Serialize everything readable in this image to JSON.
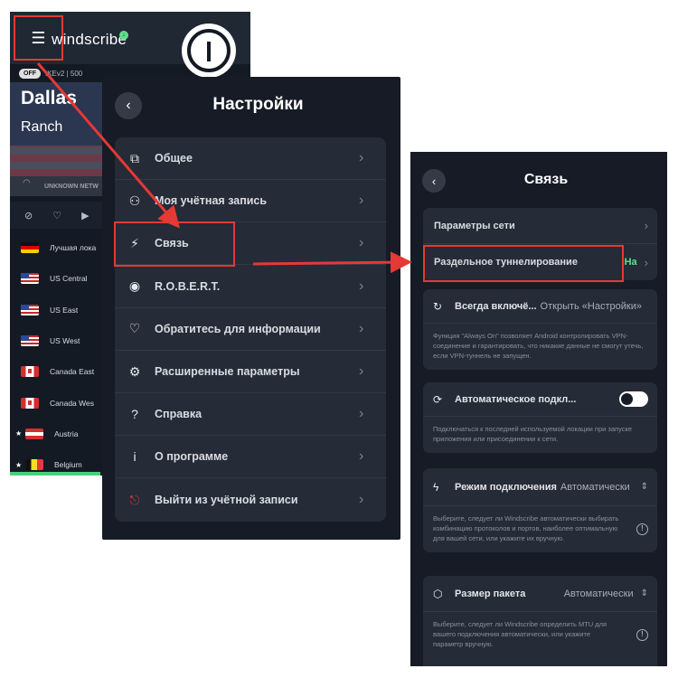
{
  "app": {
    "brand": "windscribe",
    "status": "OFF",
    "protocol": "IKEv2 | 500",
    "city": "Dallas",
    "node": "Ranch",
    "network": "UNKNOWN NETW",
    "locations": [
      {
        "name": "Лучшая лока",
        "flag": "de"
      },
      {
        "name": "US Central",
        "flag": "us"
      },
      {
        "name": "US East",
        "flag": "us"
      },
      {
        "name": "US West",
        "flag": "us"
      },
      {
        "name": "Canada East",
        "flag": "ca"
      },
      {
        "name": "Canada Wes",
        "flag": "ca"
      },
      {
        "name": "Austria",
        "flag": "at"
      },
      {
        "name": "Belgium",
        "flag": "be"
      }
    ]
  },
  "settings": {
    "title": "Настройки",
    "items": [
      {
        "label": "Общее",
        "icon": "general-icon"
      },
      {
        "label": "Моя учётная запись",
        "icon": "user-icon"
      },
      {
        "label": "Связь",
        "icon": "connection-icon"
      },
      {
        "label": "R.O.B.E.R.T.",
        "icon": "robert-icon"
      },
      {
        "label": "Обратитесь для информации",
        "icon": "heart-icon"
      },
      {
        "label": "Расширенные параметры",
        "icon": "gear-icon"
      },
      {
        "label": "Справка",
        "icon": "help-icon"
      },
      {
        "label": "О программе",
        "icon": "info-icon"
      },
      {
        "label": "Выйти из учётной записи",
        "icon": "logout-icon"
      }
    ]
  },
  "connection": {
    "title": "Связь",
    "network_params": "Параметры сети",
    "split_tunnel": "Раздельное туннелирование",
    "split_tunnel_value": "На",
    "always_on": {
      "label": "Всегда включё...",
      "value": "Открыть «Настройки»",
      "desc": "Функция \"Always On\" позволяет Android контролировать VPN-соединение и гарантировать, что никакие данные не смогут утечь, если VPN-туннель не запущен."
    },
    "auto_connect": {
      "label": "Автоматическое подкл...",
      "desc": "Подключаться к последней используемой локации при запуске приложения или присоединении к сети."
    },
    "connect_mode": {
      "label": "Режим подключения",
      "value": "Автоматически",
      "desc": "Выберите, следует ли Windscribe автоматически выбирать комбинацию протоколов и портов, наиболее оптимальную для вашей сети, или укажите их вручную."
    },
    "packet_size": {
      "label": "Размер пакета",
      "value": "Автоматически",
      "desc": "Выберите, следует ли Windscribe определить MTU для вашего подключения автоматически, или укажите параметр вручную."
    }
  },
  "colors": {
    "accent_red": "#e53935",
    "green": "#5ee08a",
    "bg": "#161b25",
    "card": "#252b37"
  }
}
